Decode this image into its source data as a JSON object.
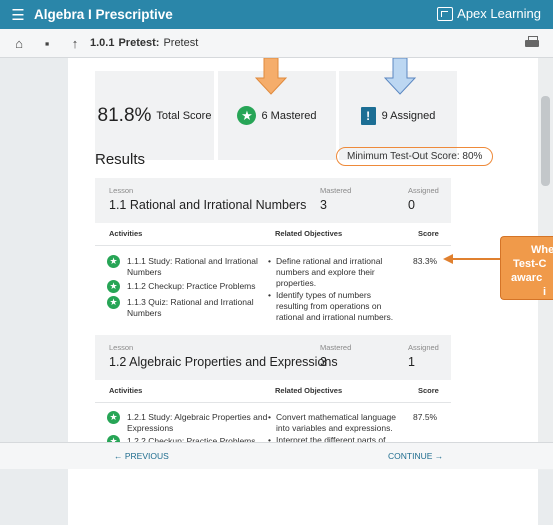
{
  "header": {
    "title": "Algebra I Prescriptive",
    "brand": "Apex Learning"
  },
  "breadcrumb": {
    "number": "1.0.1",
    "bold": "Pretest:",
    "text": "Pretest"
  },
  "summary": {
    "score_value": "81.8%",
    "score_label": "Total Score",
    "mastered": "6 Mastered",
    "assigned": "9 Assigned"
  },
  "results": {
    "title": "Results",
    "min_score": "Minimum Test-Out Score: 80%",
    "labels": {
      "lesson": "Lesson",
      "mastered": "Mastered",
      "assigned": "Assigned",
      "activities": "Activities",
      "objectives": "Related Objectives",
      "score": "Score"
    },
    "lessons": [
      {
        "title": "1.1 Rational and Irrational Numbers",
        "mastered": "3",
        "assigned": "0",
        "activities": [
          {
            "name": "1.1.1  Study: Rational and Irrational Numbers"
          },
          {
            "name": "1.1.2  Checkup: Practice Problems"
          },
          {
            "name": "1.1.3  Quiz: Rational and Irrational Numbers"
          }
        ],
        "objectives": [
          "Define rational and irrational numbers and explore their properties.",
          "Identify types of numbers resulting from operations on rational and irrational numbers."
        ],
        "score": "83.3%"
      },
      {
        "title": "1.2 Algebraic Properties and Expressions",
        "mastered": "3",
        "assigned": "1",
        "activities": [
          {
            "name": "1.2.1  Study: Algebraic Properties and Expressions"
          },
          {
            "name": "1.2.2  Checkup: Practice Problems"
          }
        ],
        "objectives": [
          "Convert mathematical language into variables and expressions.",
          "Interpret the different parts of"
        ],
        "score": "87.5%"
      }
    ]
  },
  "footer": {
    "previous": "← PREVIOUS",
    "continue": "CONTINUE →"
  },
  "callout": {
    "lines": [
      "When",
      "Test-C",
      "awarc",
      "i"
    ]
  },
  "colors": {
    "header": "#2a86a9",
    "mastered": "#27a556",
    "assigned": "#1c6e94",
    "callout": "#f09a4a",
    "arrow_orange": "#f5ad6b",
    "arrow_blue": "#bcd7f2"
  }
}
